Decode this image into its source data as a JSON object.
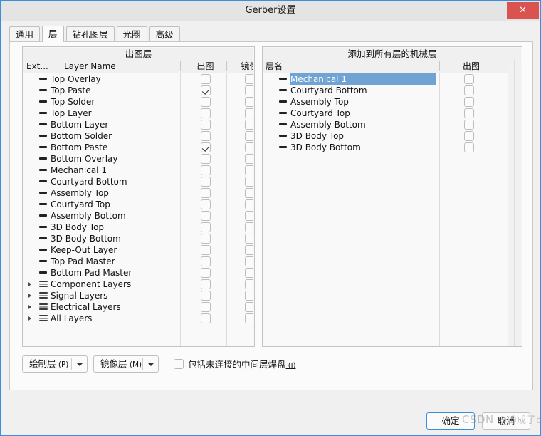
{
  "window": {
    "title": "Gerber设置",
    "close_label": "✕"
  },
  "tabs": [
    {
      "label": "通用",
      "active": false
    },
    {
      "label": "层",
      "active": true
    },
    {
      "label": "钻孔图层",
      "active": false
    },
    {
      "label": "光圈",
      "active": false
    },
    {
      "label": "高级",
      "active": false
    }
  ],
  "left_panel": {
    "caption": "出图层",
    "columns": [
      "Ext...",
      "Layer Name",
      "出图",
      "镜像"
    ],
    "rows": [
      {
        "name": "Top Overlay",
        "kind": "single",
        "plot": false,
        "mirror": false
      },
      {
        "name": "Top Paste",
        "kind": "single",
        "plot": true,
        "mirror": false
      },
      {
        "name": "Top Solder",
        "kind": "single",
        "plot": false,
        "mirror": false
      },
      {
        "name": "Top Layer",
        "kind": "single",
        "plot": false,
        "mirror": false
      },
      {
        "name": "Bottom Layer",
        "kind": "single",
        "plot": false,
        "mirror": false
      },
      {
        "name": "Bottom Solder",
        "kind": "single",
        "plot": false,
        "mirror": false
      },
      {
        "name": "Bottom Paste",
        "kind": "single",
        "plot": true,
        "mirror": false
      },
      {
        "name": "Bottom Overlay",
        "kind": "single",
        "plot": false,
        "mirror": false
      },
      {
        "name": "Mechanical 1",
        "kind": "single",
        "plot": false,
        "mirror": false
      },
      {
        "name": "Courtyard Bottom",
        "kind": "single",
        "plot": false,
        "mirror": false
      },
      {
        "name": "Assembly Top",
        "kind": "single",
        "plot": false,
        "mirror": false
      },
      {
        "name": "Courtyard Top",
        "kind": "single",
        "plot": false,
        "mirror": false
      },
      {
        "name": "Assembly Bottom",
        "kind": "single",
        "plot": false,
        "mirror": false
      },
      {
        "name": "3D Body Top",
        "kind": "single",
        "plot": false,
        "mirror": false
      },
      {
        "name": "3D Body Bottom",
        "kind": "single",
        "plot": false,
        "mirror": false
      },
      {
        "name": "Keep-Out Layer",
        "kind": "single",
        "plot": false,
        "mirror": false
      },
      {
        "name": "Top Pad Master",
        "kind": "single",
        "plot": false,
        "mirror": false
      },
      {
        "name": "Bottom Pad Master",
        "kind": "single",
        "plot": false,
        "mirror": false
      },
      {
        "name": "Component Layers",
        "kind": "group",
        "plot": false,
        "mirror": false
      },
      {
        "name": "Signal Layers",
        "kind": "group",
        "plot": false,
        "mirror": false
      },
      {
        "name": "Electrical Layers",
        "kind": "group",
        "plot": false,
        "mirror": false
      },
      {
        "name": "All Layers",
        "kind": "group",
        "plot": false,
        "mirror": false
      }
    ]
  },
  "right_panel": {
    "caption": "添加到所有层的机械层",
    "columns": [
      "层名",
      "出图"
    ],
    "rows": [
      {
        "name": "Mechanical 1",
        "kind": "single",
        "plot": false,
        "selected": true
      },
      {
        "name": "Courtyard Bottom",
        "kind": "single",
        "plot": false,
        "selected": false
      },
      {
        "name": "Assembly Top",
        "kind": "single",
        "plot": false,
        "selected": false
      },
      {
        "name": "Courtyard Top",
        "kind": "single",
        "plot": false,
        "selected": false
      },
      {
        "name": "Assembly Bottom",
        "kind": "single",
        "plot": false,
        "selected": false
      },
      {
        "name": "3D Body Top",
        "kind": "single",
        "plot": false,
        "selected": false
      },
      {
        "name": "3D Body Bottom",
        "kind": "single",
        "plot": false,
        "selected": false
      }
    ]
  },
  "bottom_bar": {
    "plot_layers_button": {
      "text": "绘制层",
      "accel": "P"
    },
    "mirror_layers_button": {
      "text": "镜像层",
      "accel": "M"
    },
    "include_pads_checkbox": {
      "text": "包括未连接的中间层焊盘",
      "accel": "I",
      "checked": false
    }
  },
  "footer": {
    "ok_label": "确定",
    "cancel_label": "取消"
  },
  "watermark": {
    "text1": "CSDN",
    "text2": "@帅成子o"
  },
  "colors": {
    "window_border": "#3a8edb",
    "close_button": "#d9534f",
    "selection": "#6ea3d3",
    "panel_bg": "#f6f6f6",
    "list_bg": "#f9f9f9"
  }
}
